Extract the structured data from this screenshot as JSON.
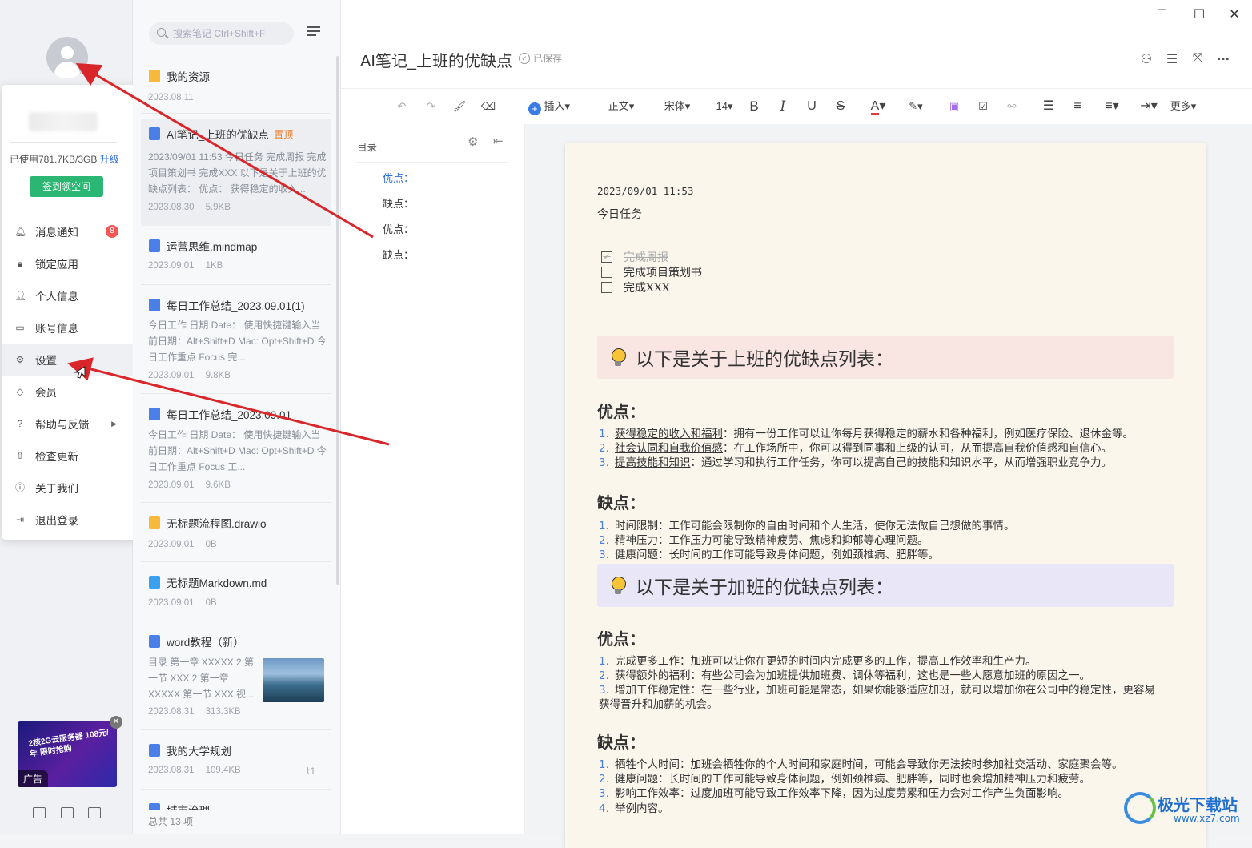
{
  "sidebar": {
    "quota_text": "已使用781.7KB/3GB",
    "upgrade": "升级",
    "sign_button": "签到领空间",
    "menu": [
      {
        "label": "消息通知",
        "icon": "bell-icon",
        "badge": "8"
      },
      {
        "label": "锁定应用",
        "icon": "lock-icon"
      },
      {
        "label": "个人信息",
        "icon": "person-icon"
      },
      {
        "label": "账号信息",
        "icon": "monitor-icon"
      },
      {
        "label": "设置",
        "icon": "gear-icon"
      },
      {
        "label": "会员",
        "icon": "diamond-icon"
      },
      {
        "label": "帮助与反馈",
        "icon": "help-icon"
      },
      {
        "label": "检查更新",
        "icon": "update-icon"
      },
      {
        "label": "关于我们",
        "icon": "info-icon"
      },
      {
        "label": "退出登录",
        "icon": "logout-icon"
      }
    ],
    "ad_text": "2核2G云服务器 108元/年 限时抢购",
    "ad_tag": "广告"
  },
  "notes": {
    "search_placeholder": "搜索笔记 Ctrl+Shift+F",
    "items": [
      {
        "title": "我的资源",
        "meta": [
          "2023.08.11"
        ]
      },
      {
        "title": "AI笔记_上班的优缺点",
        "pin": "置顶",
        "snippet": "2023/09/01 11:53 今日任务 完成周报 完成项目策划书 完成XXX 以下是关于上班的优缺点列表： 优点： 获得稳定的收入...",
        "meta": [
          "2023.08.30",
          "5.9KB"
        ]
      },
      {
        "title": "运营思维.mindmap",
        "meta": [
          "2023.09.01",
          "1KB"
        ]
      },
      {
        "title": "每日工作总结_2023.09.01(1)",
        "snippet": "今日工作 日期 Date： 使用快捷键输入当前日期：Alt+Shift+D Mac: Opt+Shift+D 今日工作重点 Focus 完...",
        "meta": [
          "2023.09.01",
          "9.8KB"
        ]
      },
      {
        "title": "每日工作总结_2023.09.01",
        "snippet": "今日工作 日期 Date： 使用快捷键输入当前日期：Alt+Shift+D Mac: Opt+Shift+D 今日工作重点 Focus 工...",
        "meta": [
          "2023.09.01",
          "9.6KB"
        ]
      },
      {
        "title": "无标题流程图.drawio",
        "meta": [
          "2023.09.01",
          "0B"
        ]
      },
      {
        "title": "无标题Markdown.md",
        "meta": [
          "2023.09.01",
          "0B"
        ]
      },
      {
        "title": "word教程（新）",
        "snippet": "目录 第一章 XXXXX 2 第一节 XXX 2 第一章 XXXXX 第一节 XXX 视...",
        "meta": [
          "2023.08.31",
          "313.3KB"
        ]
      },
      {
        "title": "我的大学规划",
        "meta": [
          "2023.08.31",
          "109.4KB"
        ],
        "attach": "1"
      },
      {
        "title": "城市治理"
      }
    ],
    "count": "总共 13 项"
  },
  "editor": {
    "title": "AI笔记_上班的优缺点",
    "saved": "已保存",
    "toolbar": {
      "insert": "插入",
      "style": "正文",
      "font": "宋体",
      "size": "14",
      "more": "更多"
    },
    "toc_title": "目录",
    "toc": [
      "优点：",
      "缺点：",
      "优点：",
      "缺点："
    ],
    "doc": {
      "date": "2023/09/01 11:53",
      "today": "今日任务",
      "tasks": [
        {
          "text": "完成周报",
          "done": true
        },
        {
          "text": "完成项目策划书",
          "done": false
        },
        {
          "text": "完成XXX",
          "done": false
        }
      ],
      "callout1": "以下是关于上班的优缺点列表：",
      "callout2": "以下是关于加班的优缺点列表：",
      "h_pro": "优点：",
      "h_con": "缺点：",
      "work_pros": [
        {
          "head": "获得稳定的收入和福利",
          "text": "：拥有一份工作可以让你每月获得稳定的薪水和各种福利，例如医疗保险、退休金等。"
        },
        {
          "head": "社会认同和自我价值感",
          "text": "：在工作场所中，你可以得到同事和上级的认可，从而提高自我价值感和自信心。"
        },
        {
          "head": "提高技能和知识",
          "text": "：通过学习和执行工作任务，你可以提高自己的技能和知识水平，从而增强职业竞争力。"
        }
      ],
      "work_cons": [
        "时间限制：工作可能会限制你的自由时间和个人生活，使你无法做自己想做的事情。",
        "精神压力：工作压力可能导致精神疲劳、焦虑和抑郁等心理问题。",
        "健康问题：长时间的工作可能导致身体问题，例如颈椎病、肥胖等。"
      ],
      "ot_pros": [
        "完成更多工作：加班可以让你在更短的时间内完成更多的工作，提高工作效率和生产力。",
        "获得额外的福利：有些公司会为加班提供加班费、调休等福利，这也是一些人愿意加班的原因之一。",
        "增加工作稳定性：在一些行业，加班可能是常态，如果你能够适应加班，就可以增加你在公司中的稳定性，更容易获得晋升和加薪的机会。"
      ],
      "ot_cons": [
        "牺牲个人时间：加班会牺牲你的个人时间和家庭时间，可能会导致你无法按时参加社交活动、家庭聚会等。",
        "健康问题：长时间的工作可能导致身体问题，例如颈椎病、肥胖等，同时也会增加精神压力和疲劳。",
        "影响工作效率：过度加班可能导致工作效率下降，因为过度劳累和压力会对工作产生负面影响。",
        "举例内容。"
      ]
    }
  },
  "watermark": {
    "name": "极光下载站",
    "url": "www.xz7.com"
  },
  "colors": {
    "accent": "#2f6ee0",
    "green": "#2bb673",
    "arrow": "#d9262b",
    "callout1": "#f9e6e3",
    "callout2": "#e8e6f7"
  }
}
